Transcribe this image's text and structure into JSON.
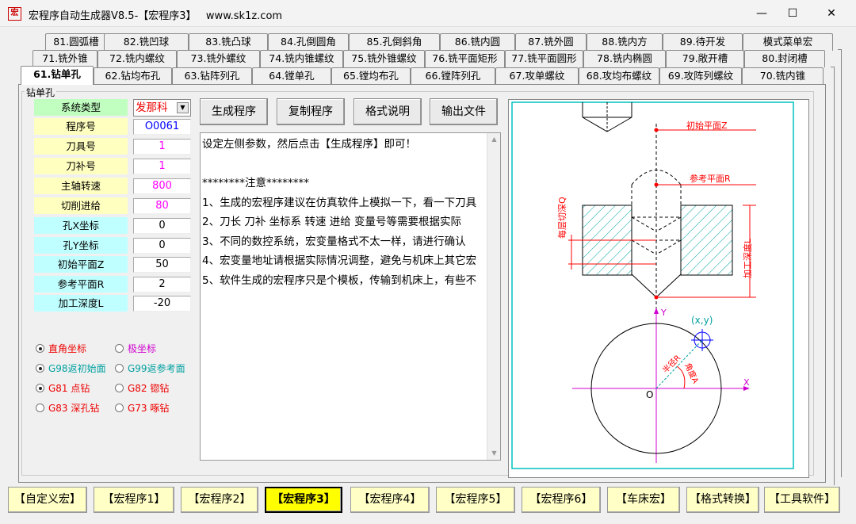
{
  "window": {
    "icon_text": "宏",
    "title": "宏程序自动生成器V8.5-【宏程序3】   www.sk1z.com",
    "minimize": "—",
    "maximize": "☐",
    "close": "✕"
  },
  "tabs_row1": [
    "81.圆弧槽",
    "82.铣凹球",
    "83.铣凸球",
    "84.孔倒圆角",
    "85.孔倒斜角",
    "86.铣内圆",
    "87.铣外圆",
    "88.铣内方",
    "89.待开发",
    "模式菜单宏"
  ],
  "tabs_row2": [
    "71.铣外锥",
    "72.铣内螺纹",
    "73.铣外螺纹",
    "74.铣内锥螺纹",
    "75.铣外锥螺纹",
    "76.铣平面矩形",
    "77.铣平面圆形",
    "78.铣内椭圆",
    "79.敞开槽",
    "80.封闭槽"
  ],
  "tabs_row3": [
    "61.钻单孔",
    "62.钻均布孔",
    "63.钻阵列孔",
    "64.镗单孔",
    "65.镗均布孔",
    "66.镗阵列孔",
    "67.攻单螺纹",
    "68.攻均布螺纹",
    "69.攻阵列螺纹",
    "70.铣内锥"
  ],
  "active_tab": "61.钻单孔",
  "group_title": "钻单孔",
  "params": {
    "system_type": {
      "label": "系统类型",
      "value": "发那科"
    },
    "rows": [
      {
        "label": "程序号",
        "value": "O0061",
        "color": "#0000ff",
        "bg": "#ffffc0"
      },
      {
        "label": "刀具号",
        "value": "1",
        "color": "#ff00ff",
        "bg": "#ffffc0"
      },
      {
        "label": "刀补号",
        "value": "1",
        "color": "#ff00ff",
        "bg": "#ffffc0"
      },
      {
        "label": "主轴转速",
        "value": "800",
        "color": "#ff00ff",
        "bg": "#ffffc0"
      },
      {
        "label": "切削进给",
        "value": "80",
        "color": "#ff00ff",
        "bg": "#ffffc0"
      },
      {
        "label": "孔X坐标",
        "value": "0",
        "color": "#000000",
        "bg": "#c0ffff"
      },
      {
        "label": "孔Y坐标",
        "value": "0",
        "color": "#000000",
        "bg": "#c0ffff"
      },
      {
        "label": "初始平面Z",
        "value": "50",
        "color": "#000000",
        "bg": "#c0ffff"
      },
      {
        "label": "参考平面R",
        "value": "2",
        "color": "#000000",
        "bg": "#c0ffff"
      },
      {
        "label": "加工深度L",
        "value": "-20",
        "color": "#000000",
        "bg": "#c0ffff"
      }
    ]
  },
  "radios": {
    "rect_coord": "直角坐标",
    "polar_coord": "极坐标",
    "g98": "G98返初始面",
    "g99": "G99返参考面",
    "g81": "G81 点钻",
    "g82": "G82 锪钻",
    "g83": "G83 深孔钻",
    "g73": "G73 啄钻"
  },
  "action_buttons": {
    "generate": "生成程序",
    "copy": "复制程序",
    "format": "格式说明",
    "export": "输出文件"
  },
  "output_text": "设定左侧参数，然后点击【生成程序】即可！\n\n********注意********\n1、生成的宏程序建议在仿真软件上模拟一下，看一下刀具\n2、刀长 刀补 坐标系 转速 进给 变量号等需要根据实际\n3、不同的数控系统，宏变量格式不太一样，请进行确认\n4、宏变量地址请根据实际情况调整，避免与机床上其它宏\n5、软件生成的宏程序只是个模板，传输到机床上，有些不",
  "diagram": {
    "initial_plane": "初始平面Z",
    "ref_plane": "参考平面R",
    "peck_depth": "每层切深Q",
    "machining_depth": "加工深度L",
    "xy": "(x,y)",
    "y_axis": "Y",
    "x_axis": "X",
    "origin": "O",
    "radius": "半径R",
    "angle": "角度A",
    "colors": {
      "frame": "#00c0c0",
      "line": "#000000",
      "dim": "#ff0000",
      "axis": "#d000d0",
      "hatch": "#00a0a0",
      "target": "#0000ff"
    }
  },
  "bottom_buttons": [
    "【自定义宏】",
    "【宏程序1】",
    "【宏程序2】",
    "【宏程序3】",
    "【宏程序4】",
    "【宏程序5】",
    "【宏程序6】",
    "【车床宏】",
    "【格式转换】",
    "【工具软件】"
  ],
  "bottom_selected": "【宏程序3】"
}
